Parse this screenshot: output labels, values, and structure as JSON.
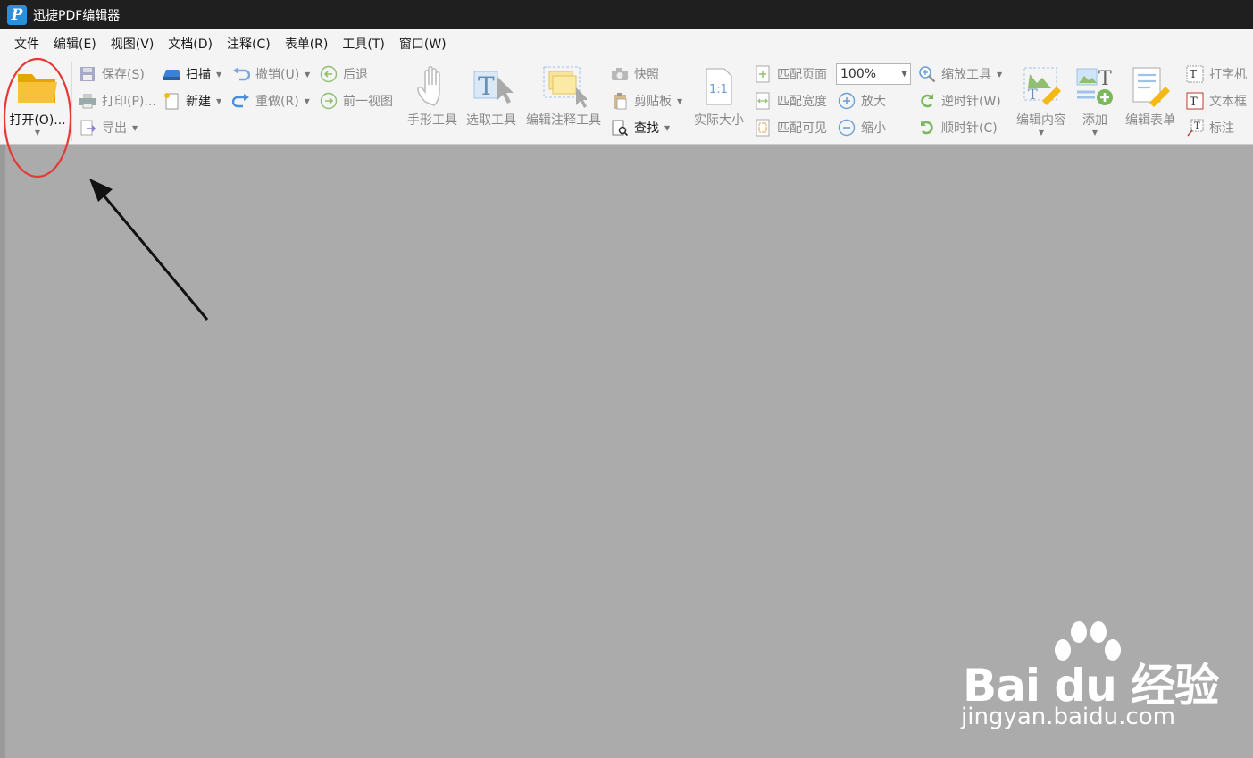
{
  "titlebar": {
    "logo_letter": "P",
    "title": "迅捷PDF编辑器"
  },
  "menu": [
    "文件",
    "编辑(E)",
    "视图(V)",
    "文档(D)",
    "注释(C)",
    "表单(R)",
    "工具(T)",
    "窗口(W)"
  ],
  "ribbon": {
    "open": "打开(O)...",
    "save": "保存(S)",
    "print": "打印(P)...",
    "export": "导出",
    "scan": "扫描",
    "new": "新建",
    "undo": "撤销(U)",
    "redo": "重做(R)",
    "back": "后退",
    "prev_view": "前一视图",
    "hand_tool": "手形工具",
    "select_tool": "选取工具",
    "edit_annot_tool": "编辑注释工具",
    "snapshot": "快照",
    "clipboard": "剪贴板",
    "find": "查找",
    "actual_size": "实际大小",
    "actual_size_icon": "1:1",
    "fit_page": "匹配页面",
    "fit_width": "匹配宽度",
    "fit_visible": "匹配可见",
    "zoom_value": "100%",
    "zoom_in": "放大",
    "zoom_out": "缩小",
    "zoom_tool": "缩放工具",
    "rotate_ccw": "逆时针(W)",
    "rotate_cw": "顺时针(C)",
    "edit_content": "编辑内容",
    "add": "添加",
    "edit_form": "编辑表单",
    "typewriter": "打字机",
    "textbox": "文本框",
    "callout": "标注"
  },
  "watermark": {
    "brand": "Bai du 经验",
    "url": "jingyan.baidu.com"
  },
  "colors": {
    "titlebar": "#1f1f1f",
    "ribbon": "#f4f4f4",
    "doc_bg": "#ababab",
    "annotation": "#e53935",
    "folder": "#f5b914",
    "icon_blue": "#4a90d9"
  }
}
